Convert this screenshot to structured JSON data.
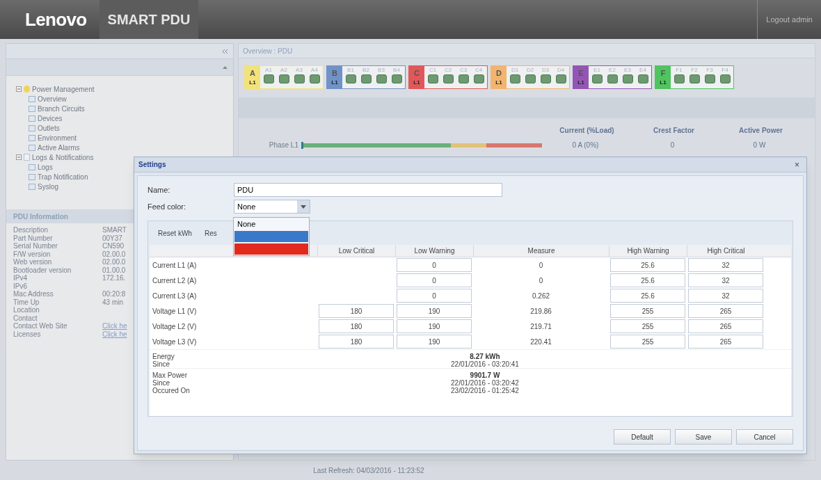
{
  "header": {
    "brand": "Lenovo",
    "product": "SMART PDU",
    "logout": "Logout admin"
  },
  "sidebar": {
    "tree": [
      {
        "label": "Power Management",
        "expanded": true,
        "children": [
          {
            "label": "Overview"
          },
          {
            "label": "Branch Circuits"
          },
          {
            "label": "Devices"
          },
          {
            "label": "Outlets"
          },
          {
            "label": "Environment"
          },
          {
            "label": "Active Alarms"
          }
        ]
      },
      {
        "label": "Logs & Notifications",
        "expanded": true,
        "children": [
          {
            "label": "Logs"
          },
          {
            "label": "Trap Notification"
          },
          {
            "label": "Syslog"
          }
        ]
      }
    ],
    "info_title": "PDU Information",
    "info": [
      {
        "label": "Description",
        "value": "SMART"
      },
      {
        "label": "Part Number",
        "value": "00Y37"
      },
      {
        "label": "Serial Number",
        "value": "CN590"
      },
      {
        "label": "F/W version",
        "value": "02.00.0"
      },
      {
        "label": "Web version",
        "value": "02.00.0"
      },
      {
        "label": "Bootloader version",
        "value": "01.00.0"
      },
      {
        "label": "IPv4",
        "value": "172.16."
      },
      {
        "label": "IPv6"
      },
      {
        "label": "Mac Address",
        "value": "00:20:8"
      },
      {
        "label": "Time Up",
        "value": "43 min"
      },
      {
        "label": "Location"
      },
      {
        "label": "Contact"
      },
      {
        "label": "Contact Web Site",
        "value": "Click he",
        "kind": "link"
      },
      {
        "label": "Licenses",
        "value": "Click he",
        "kind": "link"
      }
    ]
  },
  "overview": {
    "title": "Overview : PDU",
    "groups": [
      {
        "letter": "A",
        "line": "L1",
        "color": "#f2e27a",
        "outlets": [
          "A1",
          "A2",
          "A3",
          "A4"
        ]
      },
      {
        "letter": "B",
        "line": "L1",
        "color": "#6f93c8",
        "outlets": [
          "B1",
          "B2",
          "B3",
          "B4"
        ]
      },
      {
        "letter": "C",
        "line": "L1",
        "color": "#e0585a",
        "outlets": [
          "C1",
          "C2",
          "C3",
          "C4"
        ]
      },
      {
        "letter": "D",
        "line": "L1",
        "color": "#f2b46e",
        "outlets": [
          "D1",
          "D2",
          "D3",
          "D4"
        ]
      },
      {
        "letter": "E",
        "line": "L1",
        "color": "#9456b4",
        "outlets": [
          "E1",
          "E2",
          "E3",
          "E4"
        ]
      },
      {
        "letter": "F",
        "line": "L1",
        "color": "#4fc45f",
        "outlets": [
          "F1",
          "F2",
          "F3",
          "F4"
        ]
      }
    ],
    "columns": [
      "Current (%Load)",
      "Crest Factor",
      "Active Power"
    ],
    "phase": {
      "label": "Phase L1",
      "level": 0,
      "values": [
        "0 A (0%)",
        "0",
        "0 W"
      ]
    }
  },
  "dialog": {
    "title": "Settings",
    "close": "×",
    "name_label": "Name:",
    "name_value": "PDU",
    "feed_label": "Feed color:",
    "feed_value": "None",
    "feed_options": [
      {
        "kind": "text",
        "label": "None"
      },
      {
        "kind": "swatch",
        "color": "#3a78c9"
      },
      {
        "kind": "swatch",
        "color": "#e02a1e"
      }
    ],
    "toolbar": [
      "Reset kWh",
      "Res"
    ],
    "columns": [
      "Low Critical",
      "Low Warning",
      "Measure",
      "High Warning",
      "High Critical"
    ],
    "rows": [
      {
        "label": "Current L1 (A)",
        "low_critical": null,
        "low_warning": "0",
        "measure": "0",
        "high_warning": "25.6",
        "high_critical": "32"
      },
      {
        "label": "Current L2 (A)",
        "low_critical": null,
        "low_warning": "0",
        "measure": "0",
        "high_warning": "25.6",
        "high_critical": "32"
      },
      {
        "label": "Current L3 (A)",
        "low_critical": null,
        "low_warning": "0",
        "measure": "0.262",
        "high_warning": "25.6",
        "high_critical": "32"
      },
      {
        "label": "Voltage L1 (V)",
        "low_critical": "180",
        "low_warning": "190",
        "measure": "219.86",
        "high_warning": "255",
        "high_critical": "265"
      },
      {
        "label": "Voltage L2 (V)",
        "low_critical": "180",
        "low_warning": "190",
        "measure": "219.71",
        "high_warning": "255",
        "high_critical": "265"
      },
      {
        "label": "Voltage L3 (V)",
        "low_critical": "180",
        "low_warning": "190",
        "measure": "220.41",
        "high_warning": "255",
        "high_critical": "265"
      }
    ],
    "summary": [
      {
        "labels": [
          "Energy",
          "Since"
        ],
        "value": "8.27 kWh",
        "details": [
          "22/01/2016 - 03:20:41"
        ]
      },
      {
        "labels": [
          "Max Power",
          "Since",
          "Occured On"
        ],
        "value": "9901.7 W",
        "details": [
          "22/01/2016 - 03:20:42",
          "23/02/2016 - 01:25:42"
        ]
      }
    ],
    "buttons": [
      "Default",
      "Save",
      "Cancel"
    ]
  },
  "status_bar": "Last Refresh: 04/03/2016 - 11:23:52"
}
